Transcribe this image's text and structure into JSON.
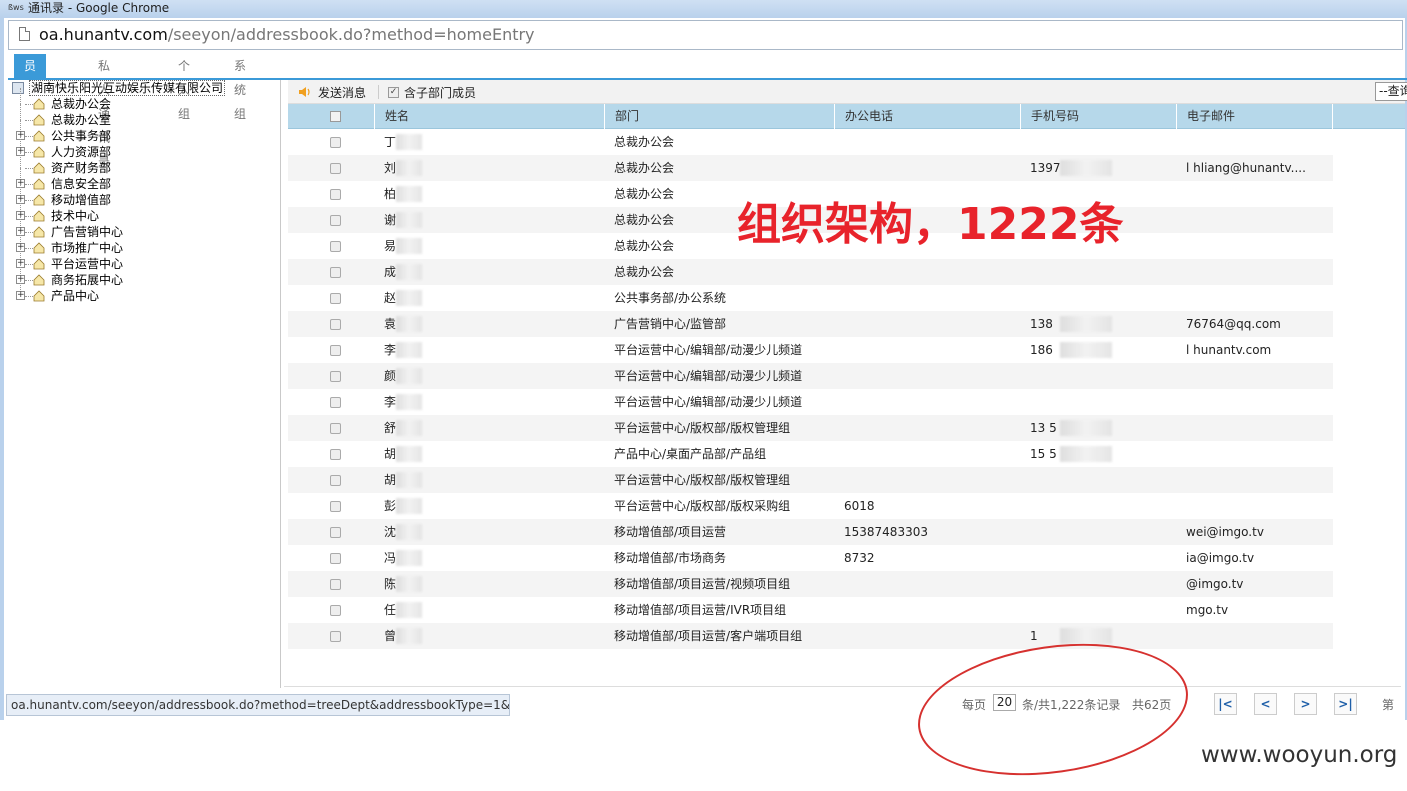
{
  "window": {
    "title": "通讯录 - Google Chrome",
    "app_icon": "ßws"
  },
  "address_bar": {
    "host": "oa.hunantv.com",
    "path": "/seeyon/addressbook.do?method=homeEntry"
  },
  "tabs": [
    "员工通讯录",
    "私人通讯录",
    "个人组",
    "系统组"
  ],
  "tree": {
    "root": "湖南快乐阳光互动娱乐传媒有限公司",
    "nodes": [
      {
        "label": "总裁办公会",
        "expandable": false
      },
      {
        "label": "总裁办公室",
        "expandable": false
      },
      {
        "label": "公共事务部",
        "expandable": true
      },
      {
        "label": "人力资源部",
        "expandable": true
      },
      {
        "label": "资产财务部",
        "expandable": false
      },
      {
        "label": "信息安全部",
        "expandable": true
      },
      {
        "label": "移动增值部",
        "expandable": true
      },
      {
        "label": "技术中心",
        "expandable": true
      },
      {
        "label": "广告营销中心",
        "expandable": true
      },
      {
        "label": "市场推广中心",
        "expandable": true
      },
      {
        "label": "平台运营中心",
        "expandable": true
      },
      {
        "label": "商务拓展中心",
        "expandable": true
      },
      {
        "label": "产品中心",
        "expandable": true
      }
    ]
  },
  "toolbar": {
    "send_message": "发送消息",
    "include_sub": "含子部门成员",
    "query": "--查询"
  },
  "grid": {
    "columns": [
      "姓名",
      "部门",
      "办公电话",
      "手机号码",
      "电子邮件"
    ],
    "rows": [
      {
        "name": "丁",
        "dept": "总裁办公会",
        "tel": "",
        "mobile": "",
        "email": ""
      },
      {
        "name": "刘",
        "dept": "总裁办公会",
        "tel": "",
        "mobile": "1397",
        "email": "l      hliang@hunantv...."
      },
      {
        "name": "柏",
        "dept": "总裁办公会",
        "tel": "",
        "mobile": "",
        "email": ""
      },
      {
        "name": "谢",
        "dept": "总裁办公会",
        "tel": "",
        "mobile": "",
        "email": ""
      },
      {
        "name": "易",
        "dept": "总裁办公会",
        "tel": "",
        "mobile": "",
        "email": ""
      },
      {
        "name": "成",
        "dept": "总裁办公会",
        "tel": "",
        "mobile": "",
        "email": ""
      },
      {
        "name": "赵",
        "dept": "公共事务部/办公系统",
        "tel": "",
        "mobile": "",
        "email": ""
      },
      {
        "name": "袁",
        "dept": "广告营销中心/监管部",
        "tel": "",
        "mobile": "138",
        "email": "76764@qq.com"
      },
      {
        "name": "李",
        "dept": "平台运营中心/编辑部/动漫少儿频道",
        "tel": "",
        "mobile": "186",
        "email": "l      hunantv.com"
      },
      {
        "name": "颜",
        "dept": "平台运营中心/编辑部/动漫少儿频道",
        "tel": "",
        "mobile": "",
        "email": ""
      },
      {
        "name": "李",
        "dept": "平台运营中心/编辑部/动漫少儿频道",
        "tel": "",
        "mobile": "",
        "email": ""
      },
      {
        "name": "舒",
        "dept": "平台运营中心/版权部/版权管理组",
        "tel": "",
        "mobile": "13      5",
        "email": ""
      },
      {
        "name": "胡",
        "dept": "产品中心/桌面产品部/产品组",
        "tel": "",
        "mobile": "15      5",
        "email": ""
      },
      {
        "name": "胡",
        "dept": "平台运营中心/版权部/版权管理组",
        "tel": "",
        "mobile": "",
        "email": ""
      },
      {
        "name": "彭",
        "dept": "平台运营中心/版权部/版权采购组",
        "tel": "6018",
        "mobile": "",
        "email": ""
      },
      {
        "name": "沈",
        "dept": "移动增值部/项目运营",
        "tel": "15387483303",
        "mobile": "",
        "email": "wei@imgo.tv"
      },
      {
        "name": "冯",
        "dept": "移动增值部/市场商务",
        "tel": "8732",
        "mobile": "",
        "email": "ia@imgo.tv"
      },
      {
        "name": "陈",
        "dept": "移动增值部/项目运营/视频项目组",
        "tel": "",
        "mobile": "",
        "email": "@imgo.tv"
      },
      {
        "name": "任",
        "dept": "移动增值部/项目运营/IVR项目组",
        "tel": "",
        "mobile": "",
        "email": "mgo.tv"
      },
      {
        "name": "曾",
        "dept": "移动增值部/项目运营/客户端项目组",
        "tel": "",
        "mobile": "1",
        "email": ""
      }
    ]
  },
  "annotation": "组织架构，1222条",
  "pager": {
    "per_page_label": "每页",
    "page_size": "20",
    "total_text": "条/共1,222条记录",
    "pages_text": "共62页",
    "page_prefix": "第"
  },
  "status_url": "oa.hunantv.com/seeyon/addressbook.do?method=treeDept&addressbookType=1&...",
  "watermark": "www.wooyun.org",
  "colors": {
    "accent": "#3b9ad8",
    "header_bg": "#b6d8ea",
    "annotation": "#e8232b"
  }
}
